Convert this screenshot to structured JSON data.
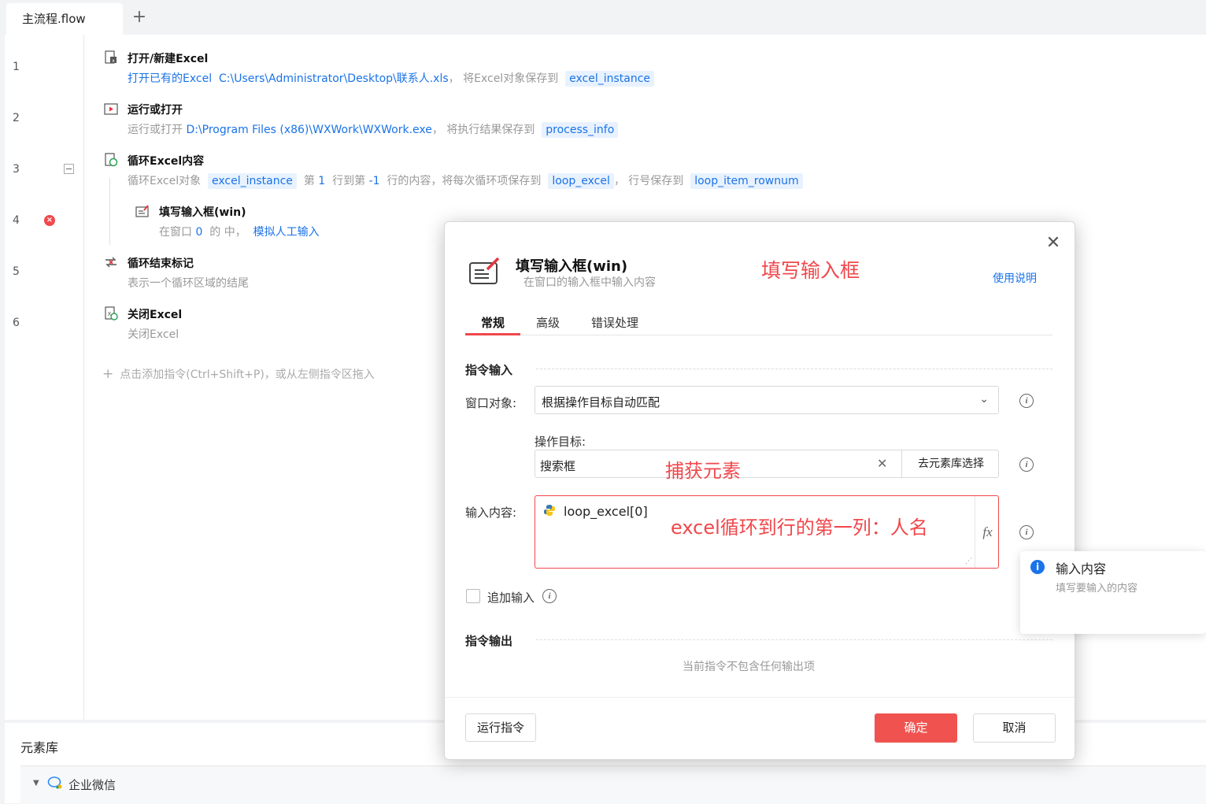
{
  "tabs": {
    "main": "主流程.flow",
    "add": "+"
  },
  "steps": [
    {
      "no": "1",
      "title": "打开/新建Excel",
      "desc_prefix": "打开已有的Excel",
      "path": "C:\\Users\\Administrator\\Desktop\\联系人.xls",
      "mid": "，  将Excel对象保存到",
      "var": "excel_instance"
    },
    {
      "no": "2",
      "title": "运行或打开",
      "desc_prefix": "运行或打开",
      "path": "D:\\Program Files (x86)\\WXWork\\WXWork.exe",
      "mid": "，  将执行结果保存到",
      "var": "process_info"
    },
    {
      "no": "3",
      "title": "循环Excel内容",
      "desc_prefix": "循环Excel对象",
      "var1": "excel_instance",
      "p1": "第",
      "n1": "1",
      "p2": "行到第",
      "n2": "-1",
      "p3": "行的内容，将每次循环项保存到",
      "var2": "loop_excel",
      "p4": "，  行号保存到",
      "var3": "loop_item_rownum"
    },
    {
      "no": "4",
      "title": "填写输入框(win)",
      "desc_prefix": "在窗口",
      "n1": "0",
      "p1": "的  中，",
      "link": "模拟人工输入"
    },
    {
      "no": "5",
      "title": "循环结束标记",
      "desc": "表示一个循环区域的结尾"
    },
    {
      "no": "6",
      "title": "关闭Excel",
      "desc": "关闭Excel"
    }
  ],
  "add_hint": "点击添加指令(Ctrl+Shift+P)，或从左侧指令区拖入",
  "element_library": {
    "title": "元素库",
    "item": "企业微信"
  },
  "modal": {
    "title": "填写输入框(win)",
    "subtitle": "在窗口的输入框中输入内容",
    "annotation": "填写输入框",
    "help": "使用说明",
    "tabs": [
      "常规",
      "高级",
      "错误处理"
    ],
    "section_input": "指令输入",
    "window_label": "窗口对象:",
    "window_value": "根据操作目标自动匹配",
    "target_label": "操作目标:",
    "target_value": "搜索框",
    "target_annotation": "捕获元素",
    "target_pick": "去元素库选择",
    "content_label": "输入内容:",
    "content_value": "loop_excel[0]",
    "content_annotation": "excel循环到行的第一列：人名",
    "fx": "fx",
    "append_label": "追加输入",
    "section_output": "指令输出",
    "no_output": "当前指令不包含任何输出项",
    "run_button": "运行指令",
    "ok_button": "确定",
    "cancel_button": "取消"
  },
  "tooltip": {
    "title": "输入内容",
    "desc": "填写要输入的内容"
  },
  "colors": {
    "accent_red": "#f0534f",
    "link_blue": "#1a73e8",
    "var_bg": "#e8f2ff"
  }
}
